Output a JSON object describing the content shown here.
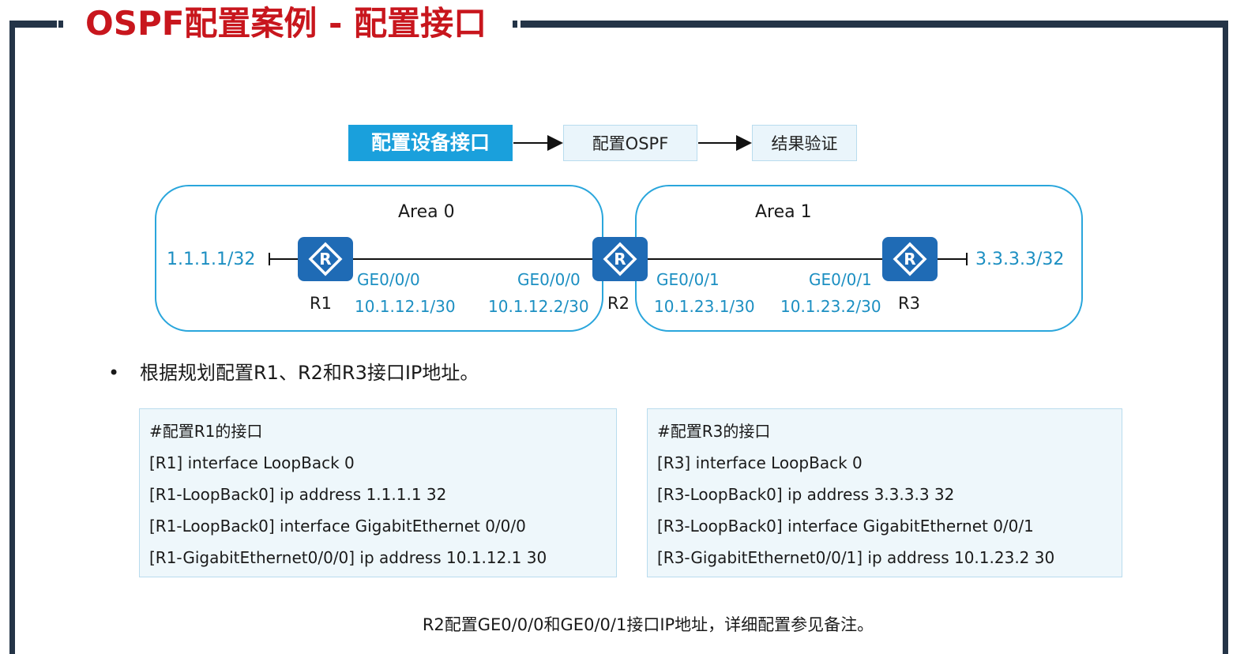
{
  "title": "OSPF配置案例 - 配置接口",
  "steps": [
    "配置设备接口",
    "配置OSPF",
    "结果验证"
  ],
  "areas": [
    "Area 0",
    "Area 1"
  ],
  "routers": [
    {
      "name": "R1",
      "icon": "router-icon"
    },
    {
      "name": "R2",
      "icon": "router-icon"
    },
    {
      "name": "R3",
      "icon": "router-icon"
    }
  ],
  "loopbacks": {
    "r1": "1.1.1.1/32",
    "r3": "3.3.3.3/32"
  },
  "links": {
    "r1_iface": "GE0/0/0",
    "r1_ip": "10.1.12.1/30",
    "r2_iface_a": "GE0/0/0",
    "r2_ip_a": "10.1.12.2/30",
    "r2_iface_b": "GE0/0/1",
    "r2_ip_b": "10.1.23.1/30",
    "r3_iface": "GE0/0/1",
    "r3_ip": "10.1.23.2/30"
  },
  "bullet": "根据规划配置R1、R2和R3接口IP地址。",
  "config_r1": [
    "#配置R1的接口",
    "[R1] interface LoopBack 0",
    "[R1-LoopBack0] ip address 1.1.1.1 32",
    "[R1-LoopBack0] interface GigabitEthernet 0/0/0",
    "[R1-GigabitEthernet0/0/0] ip address 10.1.12.1 30"
  ],
  "config_r3": [
    "#配置R3的接口",
    "[R3] interface LoopBack 0",
    "[R3-LoopBack0] ip address 3.3.3.3 32",
    "[R3-LoopBack0] interface GigabitEthernet 0/0/1",
    "[R3-GigabitEthernet0/0/1] ip address 10.1.23.2 30"
  ],
  "note": "R2配置GE0/0/0和GE0/0/1接口IP地址，详细配置参见备注。",
  "colors": {
    "title": "#c8161d",
    "accent": "#1aa0dc",
    "router": "#1f6bb5",
    "ip": "#1c8fc2",
    "frame": "#243447"
  }
}
